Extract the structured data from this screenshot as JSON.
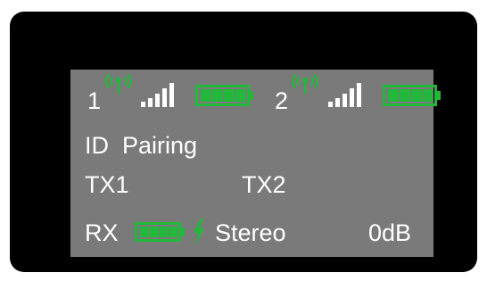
{
  "status_bar": {
    "channels": [
      {
        "number": "1",
        "signal_level": 5,
        "battery_level": 4,
        "antenna_icon": "antenna-icon"
      },
      {
        "number": "2",
        "signal_level": 5,
        "battery_level": 4,
        "antenna_icon": "antenna-icon"
      }
    ]
  },
  "menu": {
    "id_pairing_label": "ID  Pairing"
  },
  "transmitters": {
    "tx1_label": "TX1",
    "tx2_label": "TX2"
  },
  "receiver": {
    "rx_label": "RX",
    "battery_level": 4,
    "charging_icon": "lightning-icon",
    "mode_label": "Stereo",
    "gain_label": "0dB"
  },
  "colors": {
    "accent_green": "#22b83a",
    "screen_bg": "#7a7a7a",
    "text": "#ffffff",
    "frame": "#000000"
  }
}
